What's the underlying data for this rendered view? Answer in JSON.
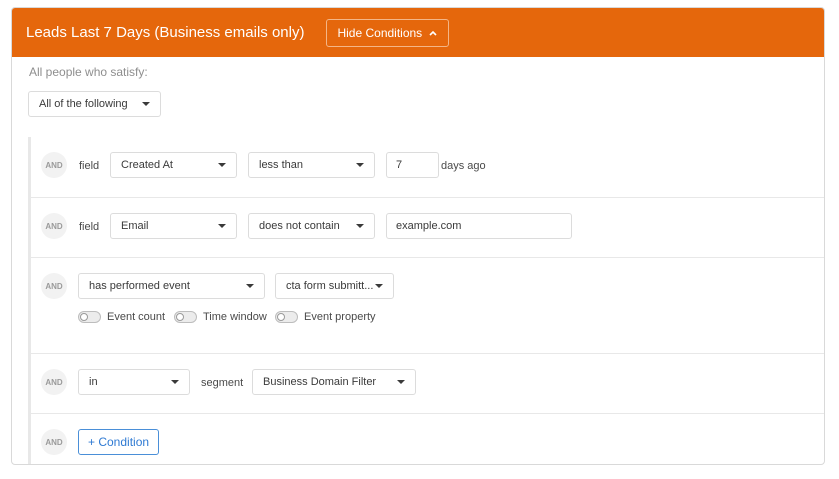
{
  "header": {
    "title": "Leads Last 7 Days (Business emails only)",
    "hide_button": "Hide Conditions",
    "accent": "#e5670c"
  },
  "subtitle": "All people who satisfy:",
  "match_select": "All of the following",
  "and_label": "AND",
  "conditions": [
    {
      "prefix": "field",
      "field": "Created At",
      "operator": "less than",
      "value": "7",
      "suffix": "days ago"
    },
    {
      "prefix": "field",
      "field": "Email",
      "operator": "does not contain",
      "value": "example.com"
    },
    {
      "type_select": "has performed event",
      "event": "cta form submitt...",
      "toggles": [
        "Event count",
        "Time window",
        "Event property"
      ]
    },
    {
      "membership": "in",
      "middle_label": "segment",
      "segment": "Business Domain Filter"
    }
  ],
  "add_condition": "+ Condition",
  "colors": {
    "link_blue": "#2f7ad3",
    "border": "#dcdcdc"
  }
}
